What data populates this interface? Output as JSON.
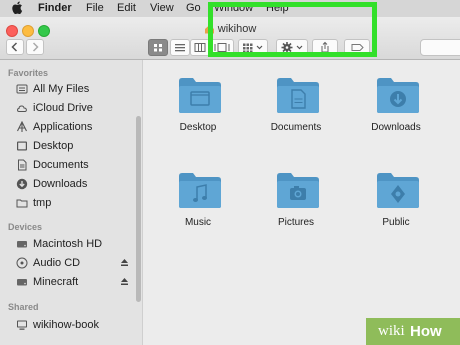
{
  "menubar": {
    "items": [
      "Finder",
      "File",
      "Edit",
      "View",
      "Go",
      "Window",
      "Help"
    ]
  },
  "window": {
    "title": "wikihow"
  },
  "sidebar": {
    "favorites_header": "Favorites",
    "favorites": [
      "All My Files",
      "iCloud Drive",
      "Applications",
      "Desktop",
      "Documents",
      "Downloads",
      "tmp"
    ],
    "devices_header": "Devices",
    "devices": [
      "Macintosh HD",
      "Audio CD",
      "Minecraft"
    ],
    "shared_header": "Shared",
    "shared": [
      "wikihow-book"
    ]
  },
  "folders": [
    {
      "label": "Desktop",
      "icon": "desktop-icon"
    },
    {
      "label": "Documents",
      "icon": "documents-icon"
    },
    {
      "label": "Downloads",
      "icon": "downloads-icon"
    },
    {
      "label": "Music",
      "icon": "music-icon"
    },
    {
      "label": "Pictures",
      "icon": "pictures-icon"
    },
    {
      "label": "Public",
      "icon": "public-icon"
    }
  ],
  "watermark": {
    "part1": "wiki",
    "part2": "How"
  },
  "colors": {
    "folder": "#5fa6d5",
    "highlight": "#33e02a",
    "watermark_bg": "#8fbc5a"
  }
}
